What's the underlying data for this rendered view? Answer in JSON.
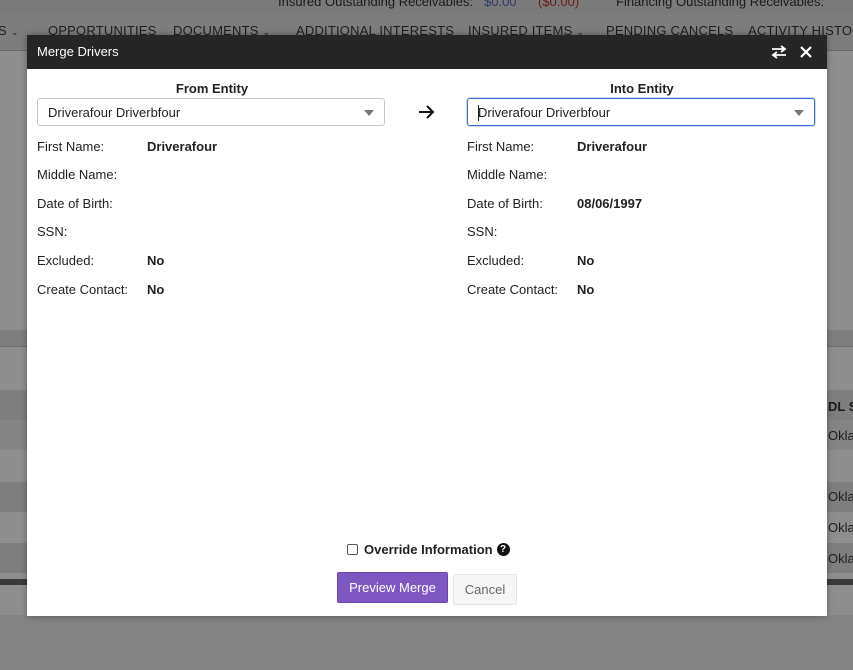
{
  "background": {
    "top_text": "Insured Outstanding Receivables:",
    "top_value": "$0.00",
    "top_value2": "($0.00)",
    "top_text2": "Financing Outstanding Receivables:",
    "nav": [
      {
        "label": "S",
        "chevron": true
      },
      {
        "label": "OPPORTUNITIES",
        "chevron": false
      },
      {
        "label": "DOCUMENTS",
        "chevron": true
      },
      {
        "label": "ADDITIONAL INTERESTS",
        "chevron": false
      },
      {
        "label": "INSURED ITEMS",
        "chevron": true
      },
      {
        "label": "PENDING CANCELS",
        "chevron": false
      },
      {
        "label": "ACTIVITY HISTORY",
        "chevron": false
      }
    ],
    "right_col_header": "DL S",
    "right_col_values": [
      "Okla",
      "Okla",
      "Okla",
      "Okla"
    ]
  },
  "modal": {
    "title": "Merge Drivers",
    "from": {
      "heading": "From Entity",
      "selected": "Driverafour Driverbfour",
      "fields": [
        {
          "label": "First Name:",
          "value": "Driverafour"
        },
        {
          "label": "Middle Name:",
          "value": ""
        },
        {
          "label": "Date of Birth:",
          "value": ""
        },
        {
          "label": "SSN:",
          "value": ""
        },
        {
          "label": "Excluded:",
          "value": "No"
        },
        {
          "label": "Create Contact:",
          "value": "No"
        }
      ]
    },
    "into": {
      "heading": "Into Entity",
      "selected": "Driverafour Driverbfour",
      "fields": [
        {
          "label": "First Name:",
          "value": "Driverafour"
        },
        {
          "label": "Middle Name:",
          "value": ""
        },
        {
          "label": "Date of Birth:",
          "value": "08/06/1997"
        },
        {
          "label": "SSN:",
          "value": ""
        },
        {
          "label": "Excluded:",
          "value": "No"
        },
        {
          "label": "Create Contact:",
          "value": "No"
        }
      ]
    },
    "override_label": "Override Information",
    "help_glyph": "?",
    "preview_button": "Preview Merge",
    "cancel_button": "Cancel"
  },
  "colors": {
    "header_bg": "#262626",
    "primary": "#7e57c2",
    "focus": "#3a6fd8"
  },
  "icons": [
    "swap-icon",
    "close-icon",
    "arrow-right-icon",
    "caret-down-icon",
    "help-icon"
  ]
}
